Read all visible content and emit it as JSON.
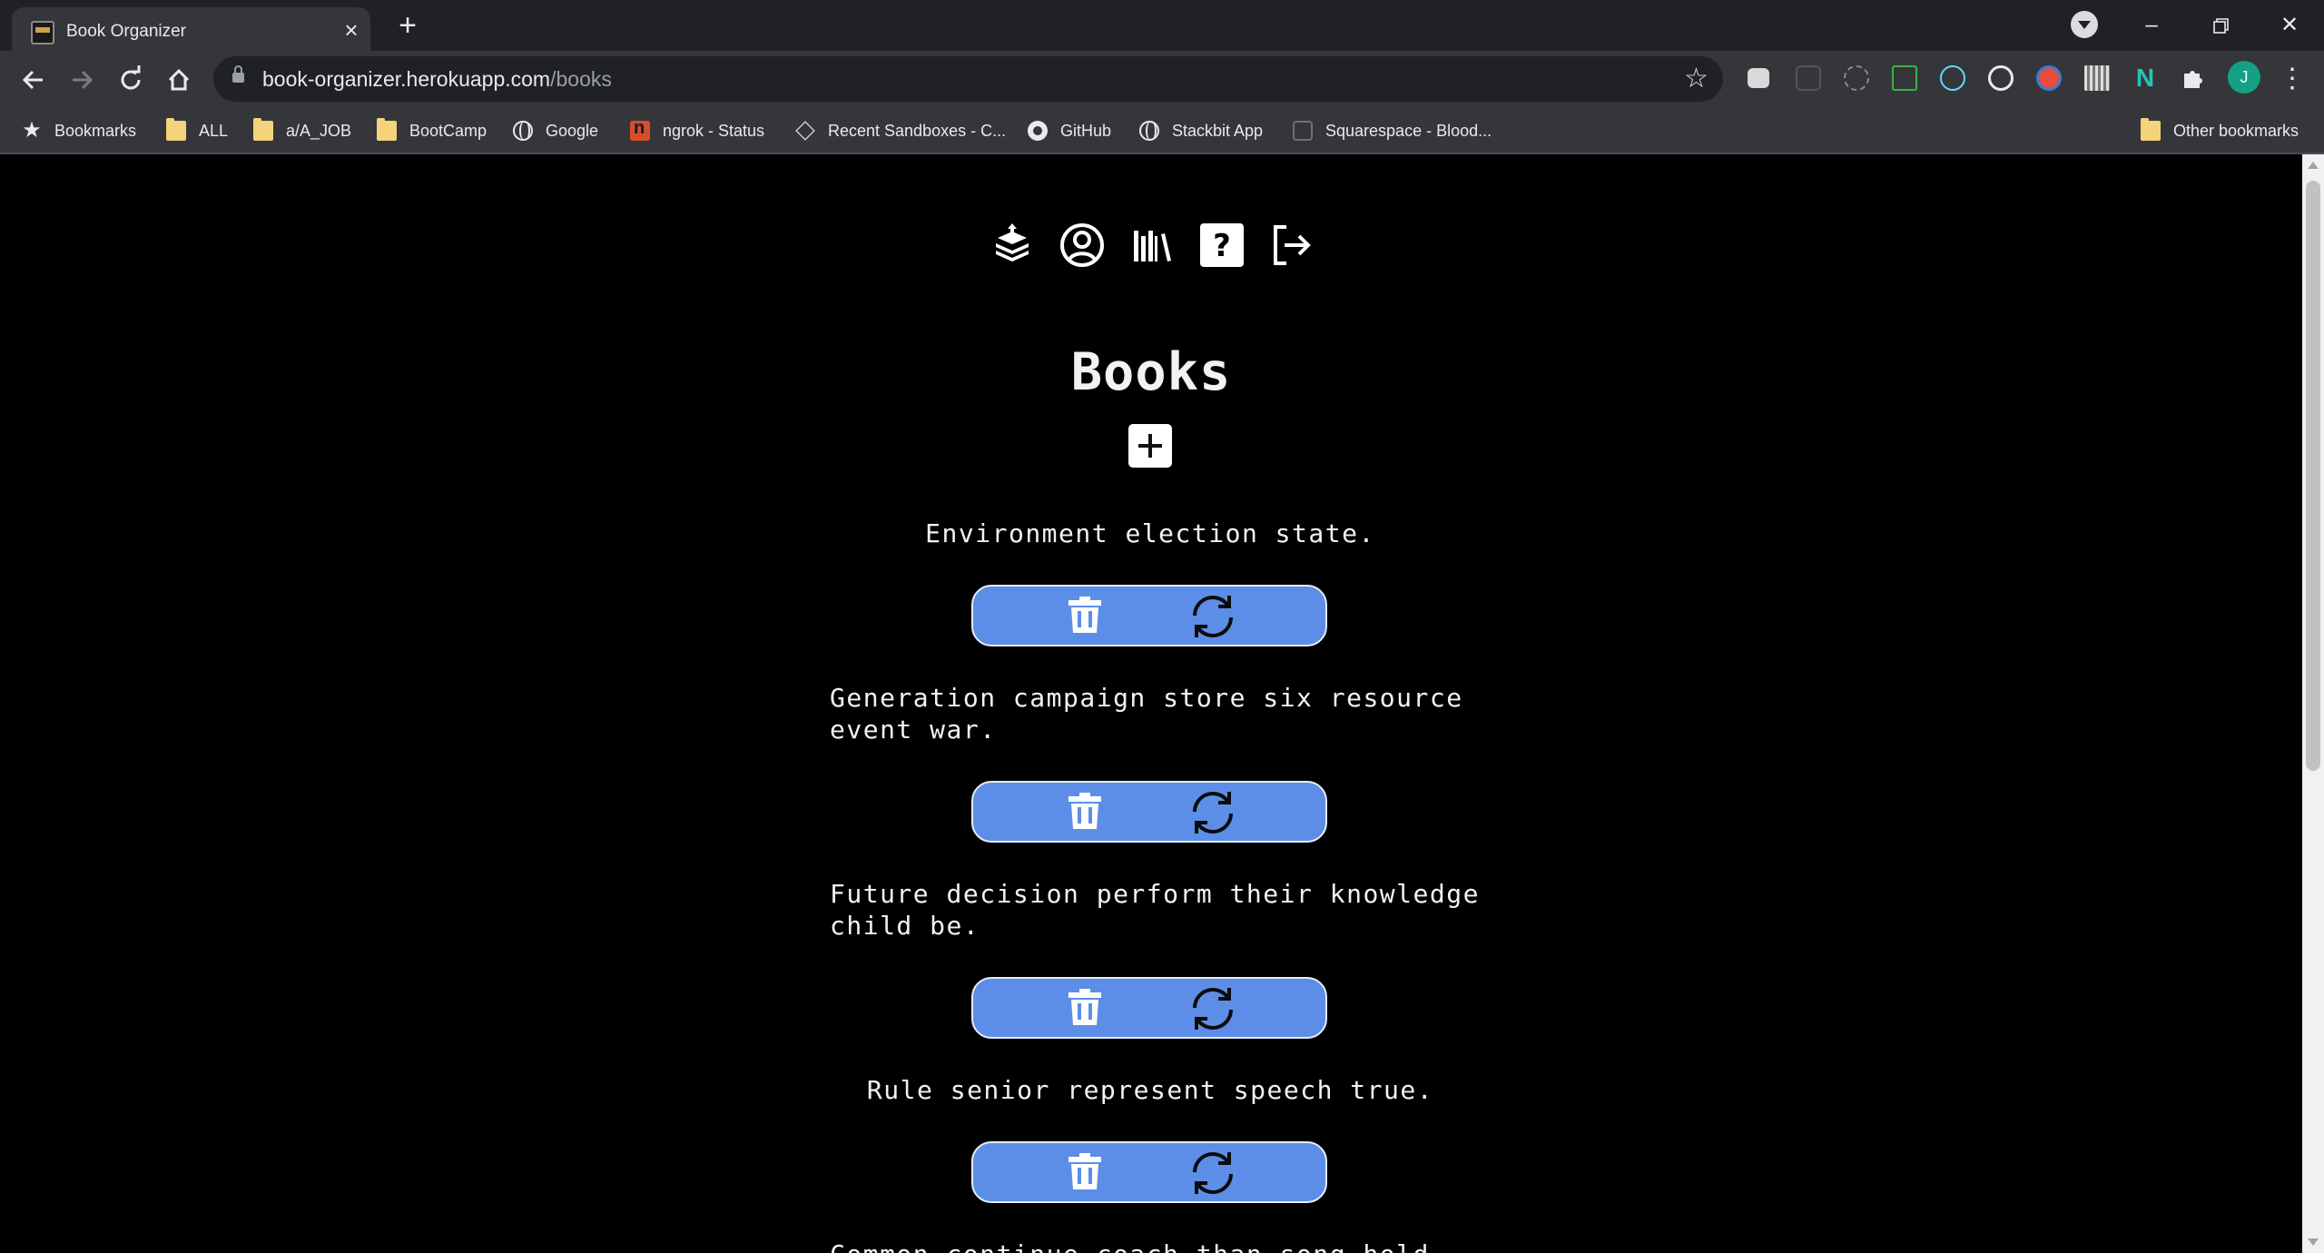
{
  "browser": {
    "tab": {
      "title": "Book Organizer"
    },
    "address": {
      "host": "book-organizer.herokuapp.com",
      "path": "/books"
    },
    "profile_initial": "J",
    "bookmarks": [
      {
        "label": "Bookmarks",
        "icon": "star-icon"
      },
      {
        "label": "ALL",
        "icon": "folder-icon"
      },
      {
        "label": "a/A_JOB",
        "icon": "folder-icon"
      },
      {
        "label": "BootCamp",
        "icon": "folder-icon"
      },
      {
        "label": "Google",
        "icon": "globe-icon"
      },
      {
        "label": "ngrok - Status",
        "icon": "ngrok-icon"
      },
      {
        "label": "Recent Sandboxes - C...",
        "icon": "codesandbox-icon"
      },
      {
        "label": "GitHub",
        "icon": "github-icon"
      },
      {
        "label": "Stackbit App",
        "icon": "globe-icon"
      },
      {
        "label": "Squarespace - Blood...",
        "icon": "squarespace-icon"
      }
    ],
    "other_bookmarks": "Other bookmarks"
  },
  "page": {
    "title": "Books",
    "nav_icons": [
      "book-stack-icon",
      "user-circle-icon",
      "library-icon",
      "help-icon",
      "logout-icon"
    ],
    "books": [
      {
        "title": "Environment election state."
      },
      {
        "title": "Generation campaign store six resource event war."
      },
      {
        "title": "Future decision perform their knowledge child be."
      },
      {
        "title": "Rule senior represent speech true."
      },
      {
        "title": "Common continue coach than song hold little"
      }
    ]
  },
  "colors": {
    "page_background": "#000000",
    "action_bar": "#5d8ee7",
    "text": "#f2f2f2",
    "browser_frame": "#202124",
    "browser_toolbar": "#35363a"
  }
}
